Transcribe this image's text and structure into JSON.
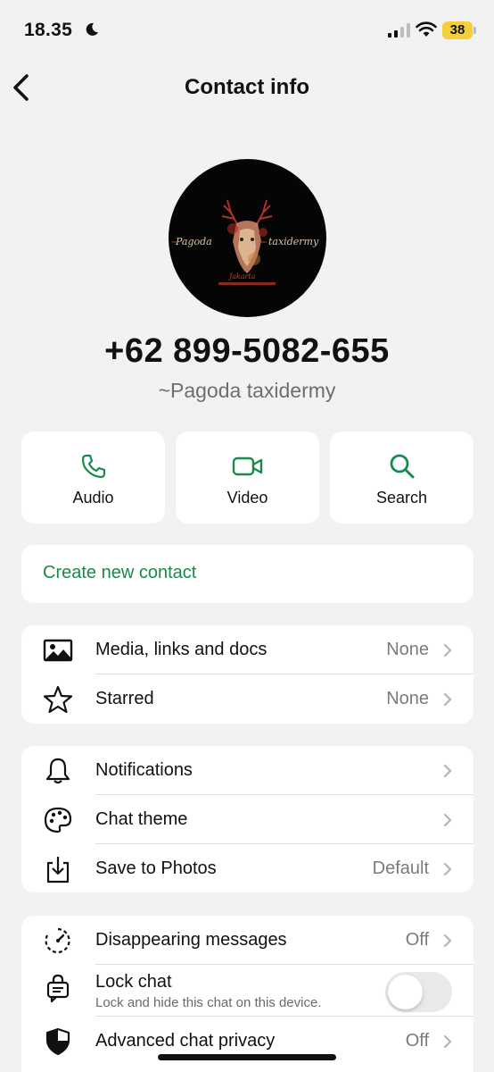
{
  "status_bar": {
    "time": "18.35",
    "battery": "38"
  },
  "header": {
    "title": "Contact info"
  },
  "profile": {
    "phone": "+62 899-5082-655",
    "name": "~Pagoda taxidermy",
    "avatar_logo_text": "Pagoda taxidermy"
  },
  "actions": [
    {
      "label": "Audio",
      "icon": "phone-icon"
    },
    {
      "label": "Video",
      "icon": "video-icon"
    },
    {
      "label": "Search",
      "icon": "search-icon"
    }
  ],
  "create_contact": {
    "label": "Create new contact"
  },
  "media_section": [
    {
      "label": "Media, links and docs",
      "value": "None",
      "icon": "image-icon"
    },
    {
      "label": "Starred",
      "value": "None",
      "icon": "star-icon"
    }
  ],
  "settings_section": [
    {
      "label": "Notifications",
      "value": "",
      "icon": "bell-icon"
    },
    {
      "label": "Chat theme",
      "value": "",
      "icon": "palette-icon"
    },
    {
      "label": "Save to Photos",
      "value": "Default",
      "icon": "download-icon"
    }
  ],
  "privacy_section": {
    "disappearing": {
      "label": "Disappearing messages",
      "value": "Off",
      "icon": "timer-icon"
    },
    "lock_chat": {
      "label": "Lock chat",
      "subtitle": "Lock and hide this chat on this device.",
      "enabled": false,
      "icon": "lock-chat-icon"
    },
    "advanced": {
      "label": "Advanced chat privacy",
      "value": "Off",
      "icon": "shield-icon"
    }
  },
  "colors": {
    "accent": "#1a8a4a",
    "background": "#f2f2f2",
    "card": "#ffffff",
    "battery": "#f5cf3a"
  }
}
